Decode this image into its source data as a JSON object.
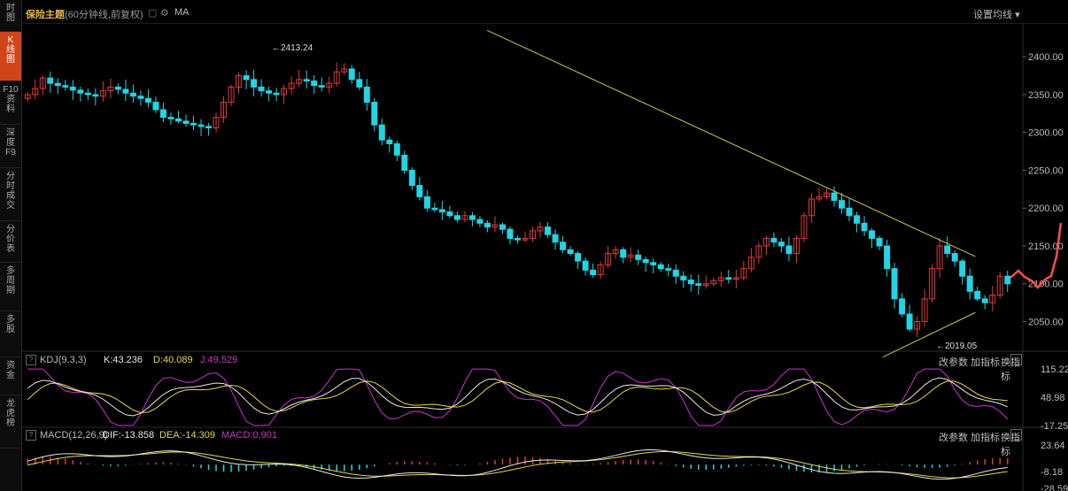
{
  "sidebar": {
    "items": [
      {
        "label": "时\n图"
      },
      {
        "label": "K\n线\n图",
        "active": true
      },
      {
        "label": "F10\n资\n料"
      },
      {
        "label": "深\n度\nF9"
      },
      {
        "label": "分\n时\n成\n交"
      },
      {
        "label": "分\n价\n表"
      },
      {
        "label": "多\n周\n期"
      },
      {
        "label": "多\n股"
      },
      {
        "label": "资\n金"
      },
      {
        "label": "龙\n虎\n榜"
      }
    ]
  },
  "header": {
    "title": "保险主题",
    "mode": "(60分钟线,前复权)",
    "indicator": "MA",
    "settings_label": "设置均线",
    "gear_icon": "gear-icon"
  },
  "colors": {
    "up": "#e03a3a",
    "down": "#1fd6e6",
    "trend": "#c9c94a",
    "k": "#e8e8e8",
    "d": "#e6d84a",
    "j": "#cc33cc",
    "dif": "#e8e8e8",
    "dea": "#e6d84a"
  },
  "price_ticks": [
    "2400.00",
    "2350.00",
    "2300.00",
    "2250.00",
    "2200.00",
    "2150.00",
    "2100.00",
    "2050.00"
  ],
  "annotations": {
    "high_label": "2413.24",
    "low_label": "2019.05"
  },
  "kdj": {
    "name": "KDJ(9,3,3)",
    "k": "K:43.236",
    "d": "D:40.089",
    "j": "J:49.529",
    "ticks": [
      "115.22",
      "48.98",
      "-17.25"
    ],
    "btn_params": "改参数",
    "btn_add": "加指标",
    "btn_switch": "换指标",
    "close": "×"
  },
  "macd": {
    "name": "MACD(12,26,9)",
    "dif": "DIF:-13.858",
    "dea": "DEA:-14.309",
    "macd": "MACD:0.901",
    "ticks": [
      "23.64",
      "-8.18",
      "-28.59"
    ],
    "btn_params": "改参数",
    "btn_add": "加指标",
    "btn_switch": "换指标",
    "close": "×"
  },
  "chart_data": {
    "type": "candlestick",
    "ylim": [
      2012,
      2440
    ],
    "high": 2413.24,
    "low": 2019.05,
    "close_series": [
      2350,
      2358,
      2372,
      2365,
      2362,
      2360,
      2356,
      2352,
      2350,
      2348,
      2355,
      2360,
      2357,
      2352,
      2348,
      2345,
      2340,
      2330,
      2320,
      2318,
      2315,
      2312,
      2310,
      2308,
      2306,
      2320,
      2340,
      2360,
      2375,
      2370,
      2360,
      2355,
      2352,
      2350,
      2358,
      2365,
      2370,
      2368,
      2362,
      2360,
      2365,
      2380,
      2384,
      2370,
      2360,
      2340,
      2310,
      2290,
      2285,
      2270,
      2250,
      2230,
      2215,
      2200,
      2198,
      2195,
      2190,
      2185,
      2190,
      2185,
      2180,
      2175,
      2178,
      2172,
      2160,
      2158,
      2160,
      2170,
      2175,
      2165,
      2155,
      2145,
      2140,
      2130,
      2118,
      2112,
      2125,
      2140,
      2145,
      2135,
      2138,
      2132,
      2128,
      2125,
      2120,
      2118,
      2110,
      2105,
      2100,
      2098,
      2100,
      2104,
      2108,
      2106,
      2108,
      2120,
      2135,
      2150,
      2160,
      2155,
      2150,
      2140,
      2160,
      2190,
      2212,
      2215,
      2220,
      2210,
      2200,
      2190,
      2180,
      2170,
      2160,
      2150,
      2120,
      2080,
      2060,
      2040,
      2050,
      2080,
      2120,
      2150,
      2140,
      2130,
      2110,
      2090,
      2080,
      2075,
      2085,
      2110,
      2100
    ],
    "trend_lines": [
      {
        "from": [
          0.465,
          2435
        ],
        "to": [
          0.955,
          2136
        ]
      },
      {
        "from": [
          0.862,
          2003
        ],
        "to": [
          0.955,
          2062
        ]
      }
    ]
  }
}
